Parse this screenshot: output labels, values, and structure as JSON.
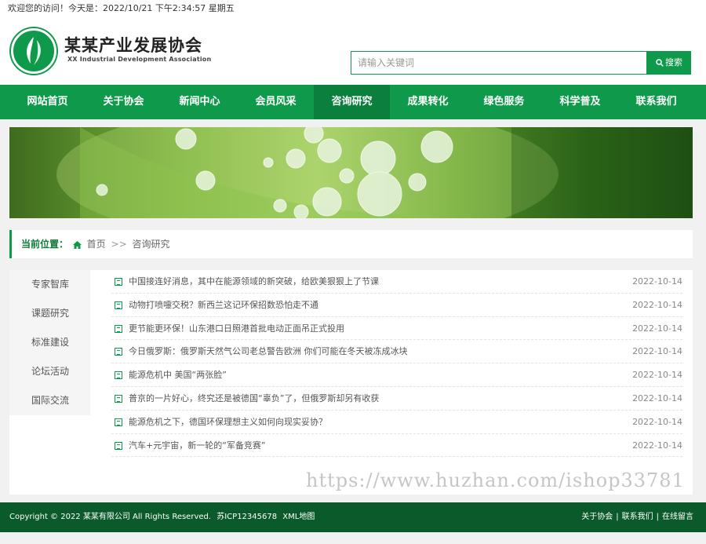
{
  "topbar": {
    "welcome": "欢迎您的访问！今天是：2022/10/21 下午2:34:57 星期五"
  },
  "brand": {
    "title": "某某产业发展协会",
    "subtitle": "XX Industrial Development Association"
  },
  "search": {
    "placeholder": "请输入关键词",
    "button": "搜索"
  },
  "nav": {
    "items": [
      "网站首页",
      "关于协会",
      "新闻中心",
      "会员风采",
      "咨询研究",
      "成果转化",
      "绿色服务",
      "科学普及",
      "联系我们"
    ],
    "active": "咨询研究"
  },
  "breadcrumb": {
    "label": "当前位置：",
    "home": "首页",
    "sep": ">>",
    "current": "咨询研究"
  },
  "sidebar": {
    "items": [
      "专家智库",
      "课题研究",
      "标准建设",
      "论坛活动",
      "国际交流"
    ]
  },
  "articles": [
    {
      "title": "中国接连好消息，其中在能源领域的新突破，给欧美狠狠上了节课",
      "date": "2022-10-14"
    },
    {
      "title": "动物打喷嚏交税？新西兰这记环保招数恐怕走不通",
      "date": "2022-10-14"
    },
    {
      "title": "更节能更环保！山东港口日照港首批电动正面吊正式投用",
      "date": "2022-10-14"
    },
    {
      "title": "今日俄罗斯：俄罗斯天然气公司老总警告欧洲 你们可能在冬天被冻成冰块",
      "date": "2022-10-14"
    },
    {
      "title": "能源危机中 美国“两张脸”",
      "date": "2022-10-14"
    },
    {
      "title": "普京的一片好心，终究还是被德国“辜负”了，但俄罗斯却另有收获",
      "date": "2022-10-14"
    },
    {
      "title": "能源危机之下，德国环保理想主义如何向现实妥协？",
      "date": "2022-10-14"
    },
    {
      "title": "汽车+元宇宙，新一轮的“军备竞赛”",
      "date": "2022-10-14"
    }
  ],
  "watermark": "https://www.huzhan.com/ishop33781",
  "footer": {
    "copyright": "Copyright © 2022 某某有限公司 All Rights Reserved.",
    "icp": "苏ICP12345678",
    "sitemap": "XML地图",
    "links": [
      "关于协会",
      "联系我们",
      "在线留言"
    ]
  },
  "colors": {
    "primary": "#0e9a4a",
    "nav_active": "#0b7f3c",
    "footer": "#0a5a2b"
  }
}
